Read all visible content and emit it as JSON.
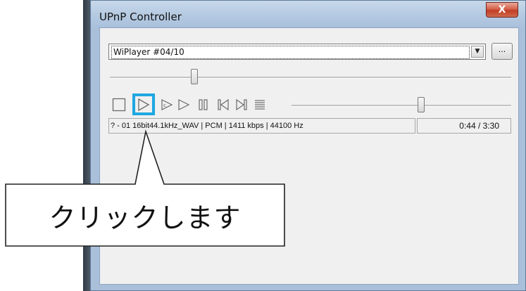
{
  "window": {
    "title": "UPnP Controller",
    "close_label": "X"
  },
  "player": {
    "selected_renderer": "WiPlayer #04/10",
    "dropdown_arrow": "▼",
    "more_label": "...",
    "seek_position": 0.21,
    "volume_level": 0.59,
    "track_info": "? - 01 16bit44.1kHz_WAV | PCM | 1411 kbps | 44100 Hz",
    "time": "0:44 / 3:30"
  },
  "controls": [
    {
      "name": "stop-icon"
    },
    {
      "name": "play-icon"
    },
    {
      "name": "continuous-play-icon"
    },
    {
      "name": "play-outline-icon"
    },
    {
      "name": "pause-icon"
    },
    {
      "name": "previous-icon"
    },
    {
      "name": "next-icon"
    },
    {
      "name": "playlist-icon"
    }
  ],
  "annotation": {
    "text": "クリックします",
    "highlight_color": "#1ea7e1"
  }
}
